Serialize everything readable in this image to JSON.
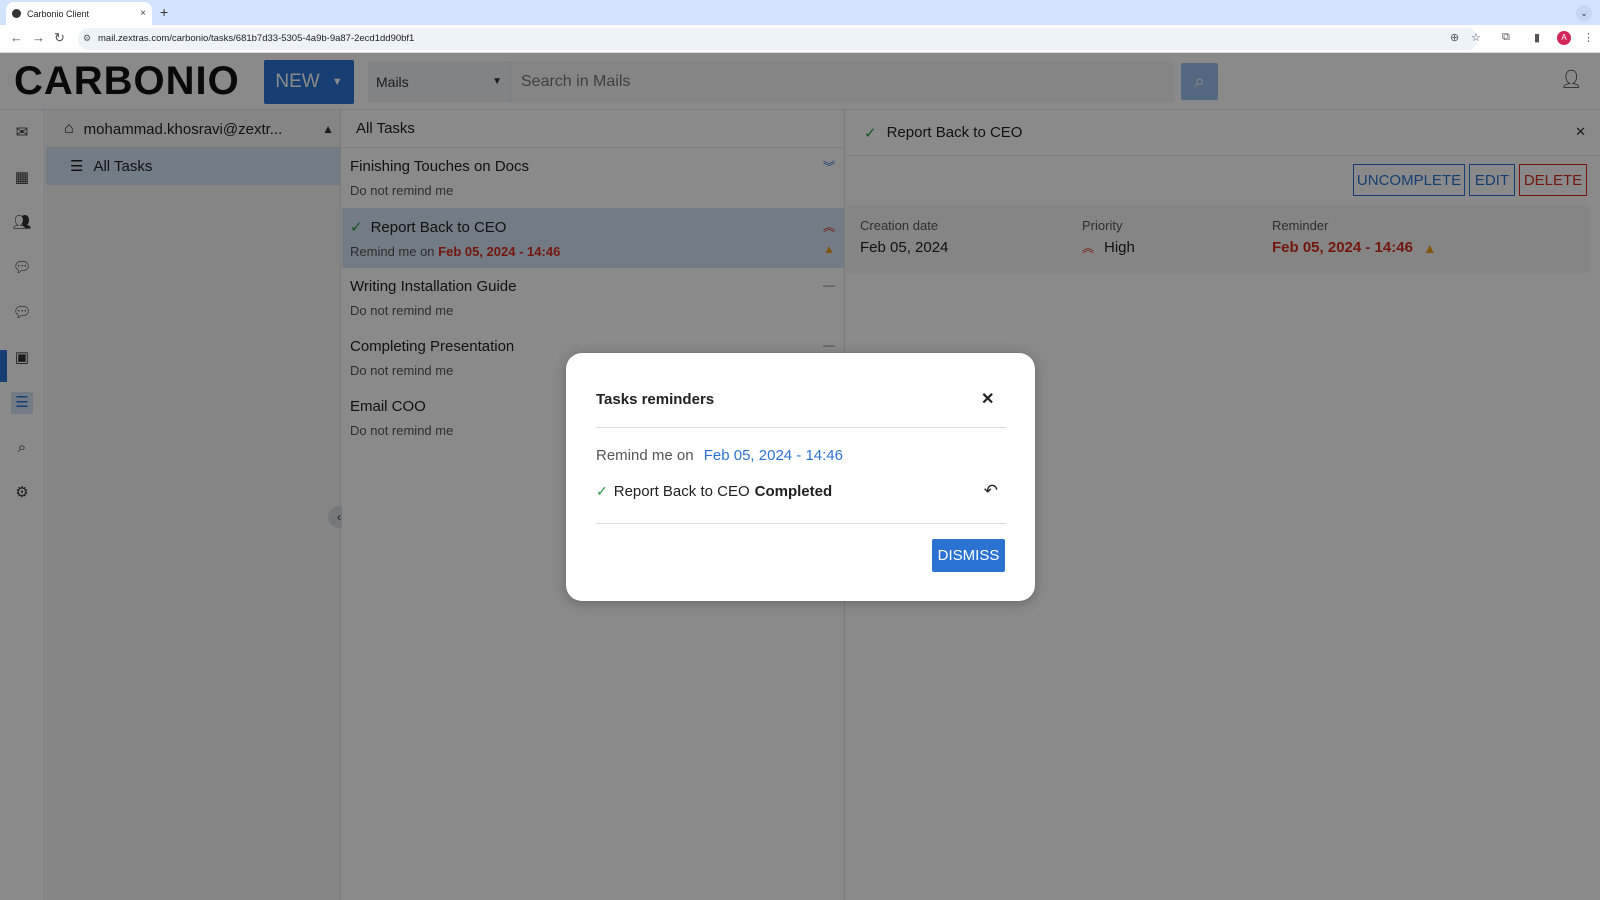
{
  "browser": {
    "tab_title": "Carbonio Client",
    "tab_close": "×",
    "new_tab": "+",
    "url": "mail.zextras.com/carbonio/tasks/681b7d33-5305-4a9b-9a87-2ecd1dd90bf1",
    "profile_initial": "A"
  },
  "header": {
    "logo": "CARBONIO",
    "new_label": "NEW",
    "module": "Mails",
    "search_placeholder": "Search in Mails"
  },
  "folders": {
    "account": "mohammad.khosravi@zextr...",
    "all_tasks": "All Tasks"
  },
  "list": {
    "title": "All Tasks",
    "tasks": [
      {
        "title": "Finishing Touches on Docs",
        "remind": "Do not remind me"
      },
      {
        "title": "Report Back to CEO",
        "remind_prefix": "Remind me on",
        "remind_date": "Feb 05, 2024 - 14:46"
      },
      {
        "title": "Writing Installation Guide",
        "remind": "Do not remind me"
      },
      {
        "title": "Completing Presentation",
        "remind": "Do not remind me"
      },
      {
        "title": "Email COO",
        "remind": "Do not remind me"
      }
    ]
  },
  "detail": {
    "title": "Report Back to CEO",
    "buttons": {
      "uncomplete": "UNCOMPLETE",
      "edit": "EDIT",
      "delete": "DELETE"
    },
    "creation_label": "Creation date",
    "creation_value": "Feb 05, 2024",
    "priority_label": "Priority",
    "priority_value": "High",
    "reminder_label": "Reminder",
    "reminder_value": "Feb 05, 2024 - 14:46"
  },
  "modal": {
    "title": "Tasks reminders",
    "remind_prefix": "Remind me on",
    "remind_date": "Feb 05, 2024 - 14:46",
    "task_title": "Report Back to CEO",
    "task_status": "Completed",
    "dismiss_label": "DISMISS"
  },
  "icons": {
    "accent": "#2b73d2",
    "danger": "#d52b1e",
    "success": "#2e9a45",
    "warning": "#f0a020"
  }
}
